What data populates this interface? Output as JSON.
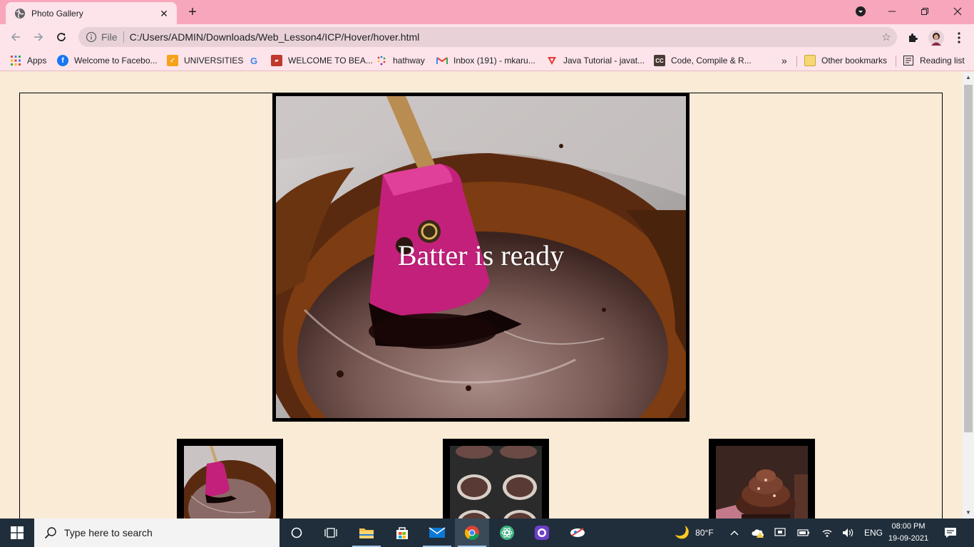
{
  "browser": {
    "tab_title": "Photo Gallery",
    "address": {
      "scheme": "File",
      "url": "C:/Users/ADMIN/Downloads/Web_Lesson4/ICP/Hover/hover.html"
    },
    "bookmarks": [
      {
        "label": "Apps",
        "icon": "apps-grid-icon"
      },
      {
        "label": "Welcome to Facebo...",
        "icon": "facebook-icon"
      },
      {
        "label": "UNIVERSITIES",
        "icon": "bookmark-folder-icon"
      },
      {
        "label": "",
        "icon": "google-icon"
      },
      {
        "label": "WELCOME TO BEA...",
        "icon": "site-icon"
      },
      {
        "label": "hathway",
        "icon": "hathway-icon"
      },
      {
        "label": "Inbox (191) - mkaru...",
        "icon": "gmail-icon"
      },
      {
        "label": "Java Tutorial - javat...",
        "icon": "javatpoint-icon"
      },
      {
        "label": "Code, Compile & R...",
        "icon": "codechef-icon"
      }
    ],
    "overflow_label": "»",
    "other_bookmarks": "Other bookmarks",
    "reading_list": "Reading list"
  },
  "page": {
    "main_caption": "Batter is ready",
    "thumbnails": [
      {
        "name": "batter-thumbnail"
      },
      {
        "name": "cupcake-tray-thumbnail"
      },
      {
        "name": "frosted-cupcake-thumbnail"
      }
    ]
  },
  "taskbar": {
    "search_placeholder": "Type here to search",
    "weather": "80°F",
    "language": "ENG",
    "time": "08:00 PM",
    "date": "19-09-2021"
  },
  "colors": {
    "tab_strip": "#f8a6bb",
    "toolbar": "#fce4ea",
    "page_background": "#faebd7",
    "taskbar": "#202e3b"
  }
}
